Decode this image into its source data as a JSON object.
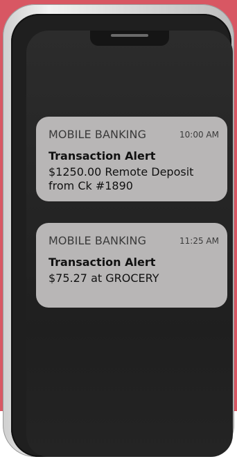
{
  "notifications": [
    {
      "app": "MOBILE BANKING",
      "time": "10:00 AM",
      "title": "Transaction Alert",
      "message": "$1250.00 Remote Deposit from Ck #1890"
    },
    {
      "app": "MOBILE BANKING",
      "time": "11:25 AM",
      "title": "Transaction Alert",
      "message": "$75.27 at GROCERY"
    }
  ],
  "colors": {
    "background_accent": "#d85763",
    "notification_bg": "#b8b6b6",
    "screen_bg": "#262626"
  }
}
